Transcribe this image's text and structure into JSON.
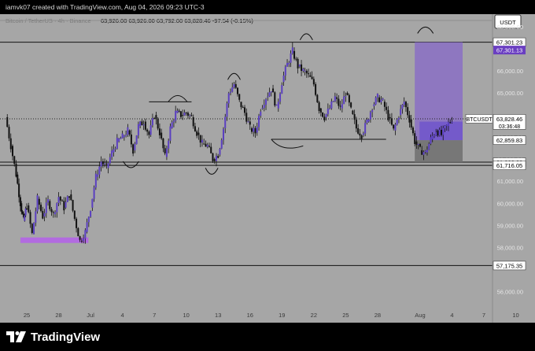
{
  "header": {
    "caption": "iamvk07 created with TradingView.com, Aug 04, 2026 09:23 UTC-3"
  },
  "ohlc_row": {
    "label": "Bitcoin / TetherUS · 4h · Binance",
    "values": "63,926.00   63,926.00   63,792.00   63,828.46   -97.54 (-0.15%)"
  },
  "currency_button": "USDT",
  "footer": {
    "brand": "TradingView"
  },
  "colors": {
    "background": "#a6a6a6",
    "candle_body": "#5a3fc0",
    "wick": "#111111",
    "box_upper": "#8a6fc4",
    "box_lower": "#6a4fcf",
    "box_loss": "#6f6f6f",
    "support_zone": "#b26be0",
    "price_label": "#ffffff",
    "purple_label": "#6a3fc1"
  },
  "chart_data": {
    "type": "candlestick",
    "symbol": "BTCUSDT",
    "last_price": 63828.46,
    "last_price_label": "63,828.46",
    "countdown": "03:36:48",
    "ylim": [
      55300,
      69200
    ],
    "y_ticks": [
      "68,000.00",
      "67,000.00",
      "66,000.00",
      "65,000.00",
      "63,000.00",
      "62,000.00",
      "61,000.00",
      "60,000.00",
      "59,000.00",
      "58,000.00",
      "56,000.00"
    ],
    "x_ticks": [
      {
        "label": "25",
        "day": -6
      },
      {
        "label": "28",
        "day": -3
      },
      {
        "label": "Jul",
        "day": 0
      },
      {
        "label": "4",
        "day": 3
      },
      {
        "label": "7",
        "day": 6
      },
      {
        "label": "10",
        "day": 9
      },
      {
        "label": "13",
        "day": 12
      },
      {
        "label": "16",
        "day": 15
      },
      {
        "label": "19",
        "day": 18
      },
      {
        "label": "22",
        "day": 21
      },
      {
        "label": "25",
        "day": 24
      },
      {
        "label": "28",
        "day": 27
      },
      {
        "label": "Aug",
        "day": 31
      },
      {
        "label": "4",
        "day": 34
      },
      {
        "label": "7",
        "day": 37
      },
      {
        "label": "10",
        "day": 40
      }
    ],
    "price_closes": [
      [
        -8,
        63900
      ],
      [
        -7.5,
        62600
      ],
      [
        -7,
        61300
      ],
      [
        -6.6,
        60000
      ],
      [
        -6.3,
        59200
      ],
      [
        -6,
        59900
      ],
      [
        -5.5,
        58600
      ],
      [
        -5,
        60200
      ],
      [
        -4.5,
        59400
      ],
      [
        -4,
        60100
      ],
      [
        -3.5,
        59500
      ],
      [
        -3,
        60300
      ],
      [
        -2.5,
        59800
      ],
      [
        -2,
        60400
      ],
      [
        -1.5,
        59300
      ],
      [
        -1,
        58300
      ],
      [
        -0.5,
        58700
      ],
      [
        0,
        59800
      ],
      [
        0.5,
        61200
      ],
      [
        1,
        61900
      ],
      [
        1.5,
        61600
      ],
      [
        2,
        62300
      ],
      [
        2.5,
        62800
      ],
      [
        3,
        63000
      ],
      [
        3.5,
        63300
      ],
      [
        4,
        62400
      ],
      [
        4.5,
        63500
      ],
      [
        5,
        63700
      ],
      [
        5.5,
        63100
      ],
      [
        6,
        64000
      ],
      [
        6.5,
        63200
      ],
      [
        7,
        62100
      ],
      [
        7.5,
        63400
      ],
      [
        8,
        64100
      ],
      [
        8.5,
        64000
      ],
      [
        9,
        64100
      ],
      [
        9.5,
        63900
      ],
      [
        10,
        63200
      ],
      [
        10.5,
        62700
      ],
      [
        11,
        62600
      ],
      [
        11.5,
        62000
      ],
      [
        12,
        62200
      ],
      [
        12.5,
        63400
      ],
      [
        13,
        65000
      ],
      [
        13.5,
        65400
      ],
      [
        14,
        64600
      ],
      [
        14.5,
        64100
      ],
      [
        15,
        63400
      ],
      [
        15.5,
        63200
      ],
      [
        16,
        64300
      ],
      [
        16.5,
        64800
      ],
      [
        17,
        65200
      ],
      [
        17.5,
        64300
      ],
      [
        18,
        65500
      ],
      [
        18.5,
        66300
      ],
      [
        19,
        66900
      ],
      [
        19.5,
        66200
      ],
      [
        20,
        66000
      ],
      [
        20.5,
        65800
      ],
      [
        21,
        65400
      ],
      [
        21.5,
        64300
      ],
      [
        22,
        63900
      ],
      [
        22.5,
        64300
      ],
      [
        23,
        64800
      ],
      [
        23.5,
        64300
      ],
      [
        24,
        65000
      ],
      [
        24.5,
        64200
      ],
      [
        25,
        63400
      ],
      [
        25.5,
        63100
      ],
      [
        26,
        63700
      ],
      [
        26.5,
        64400
      ],
      [
        27,
        64800
      ],
      [
        27.5,
        64600
      ],
      [
        28,
        63900
      ],
      [
        28.5,
        63300
      ],
      [
        29,
        64000
      ],
      [
        29.5,
        64600
      ],
      [
        30,
        63800
      ],
      [
        30.5,
        62800
      ],
      [
        31,
        62400
      ],
      [
        31.5,
        62300
      ],
      [
        32,
        62900
      ],
      [
        32.5,
        63300
      ],
      [
        33,
        63100
      ],
      [
        33.5,
        63500
      ],
      [
        34,
        63828
      ]
    ],
    "levels": [
      {
        "price": 67301.23,
        "label": "67,301.23",
        "style": "white"
      },
      {
        "price": 61862.32,
        "label": "61,862.32",
        "style": "white"
      },
      {
        "price": 61716.05,
        "label": "61,716.05",
        "style": "white"
      },
      {
        "price": 57175.35,
        "label": "57,175.35",
        "style": "white"
      },
      {
        "price": 62859.83,
        "label": "62,859.83",
        "style": "white"
      }
    ],
    "purple_level": {
      "price": 67301.13,
      "label": "67,301.13"
    },
    "position_box": {
      "x_start_day": 30.5,
      "x_end_day": 35,
      "target": 67301.13,
      "entry": 62859.83,
      "stop": 61862.32
    },
    "support_zone": {
      "price_low": 58200,
      "price_high": 58450,
      "x_start_day": -6.6,
      "x_end_day": -0.2
    }
  }
}
